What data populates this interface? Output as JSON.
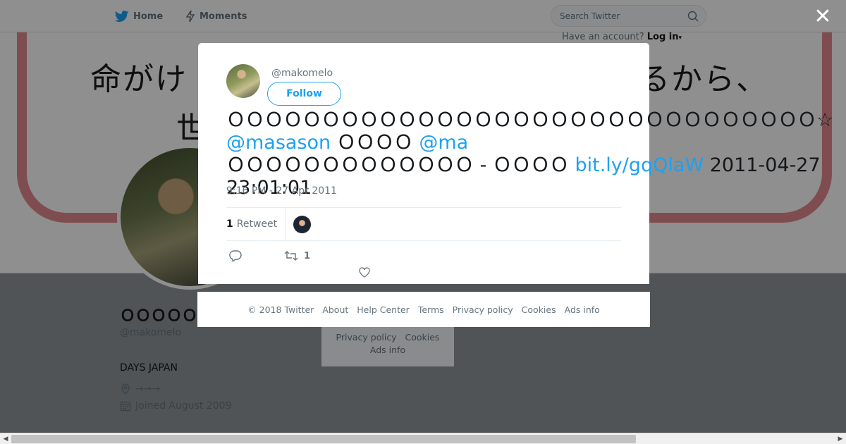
{
  "nav": {
    "home": "Home",
    "moments": "Moments",
    "search_placeholder": "Search Twitter",
    "have_account": "Have an account?",
    "login": "Log in"
  },
  "banner": {
    "line1_left": "命がけ",
    "line1_right": "いるから、",
    "line2": "世"
  },
  "profile": {
    "name": "ＯＯＯＯＯＯ",
    "handle": "@makomelo",
    "bio": "DAYS JAPAN",
    "location": "→→→",
    "joined": "Joined August 2009"
  },
  "sidecard": {
    "line1": "Privacy policy",
    "line1b": "Cookies",
    "line2": "Ads info"
  },
  "tweet": {
    "handle": "@makomelo",
    "follow": "Follow",
    "text_part1": "ＯＯＯＯＯＯＯＯＯＯＯＯＯＯＯＯＯＯＯＯＯＯＯＯＯＯＯＯＯＯＯ☆ ",
    "mention1": "@masason",
    "text_part2": " ＯＯＯＯ ",
    "mention2": "@ma",
    "text_part3": "ＯＯＯＯＯＯＯＯＯＯＯＯＯ - ＯＯＯＯ ",
    "link": "bit.ly/gqQlaW",
    "text_part4": " 2011-04-27 23:01:01",
    "time": "9:16 PM - 27 Apr 2011",
    "retweet_count": "1",
    "retweet_label": "Retweet",
    "action_retweet_count": "1"
  },
  "footer": {
    "copyright": "© 2018 Twitter",
    "about": "About",
    "help": "Help Center",
    "terms": "Terms",
    "privacy": "Privacy policy",
    "cookies": "Cookies",
    "ads": "Ads info"
  },
  "colors": {
    "accent": "#1da1f2",
    "banner_frame": "#e28a8f"
  }
}
